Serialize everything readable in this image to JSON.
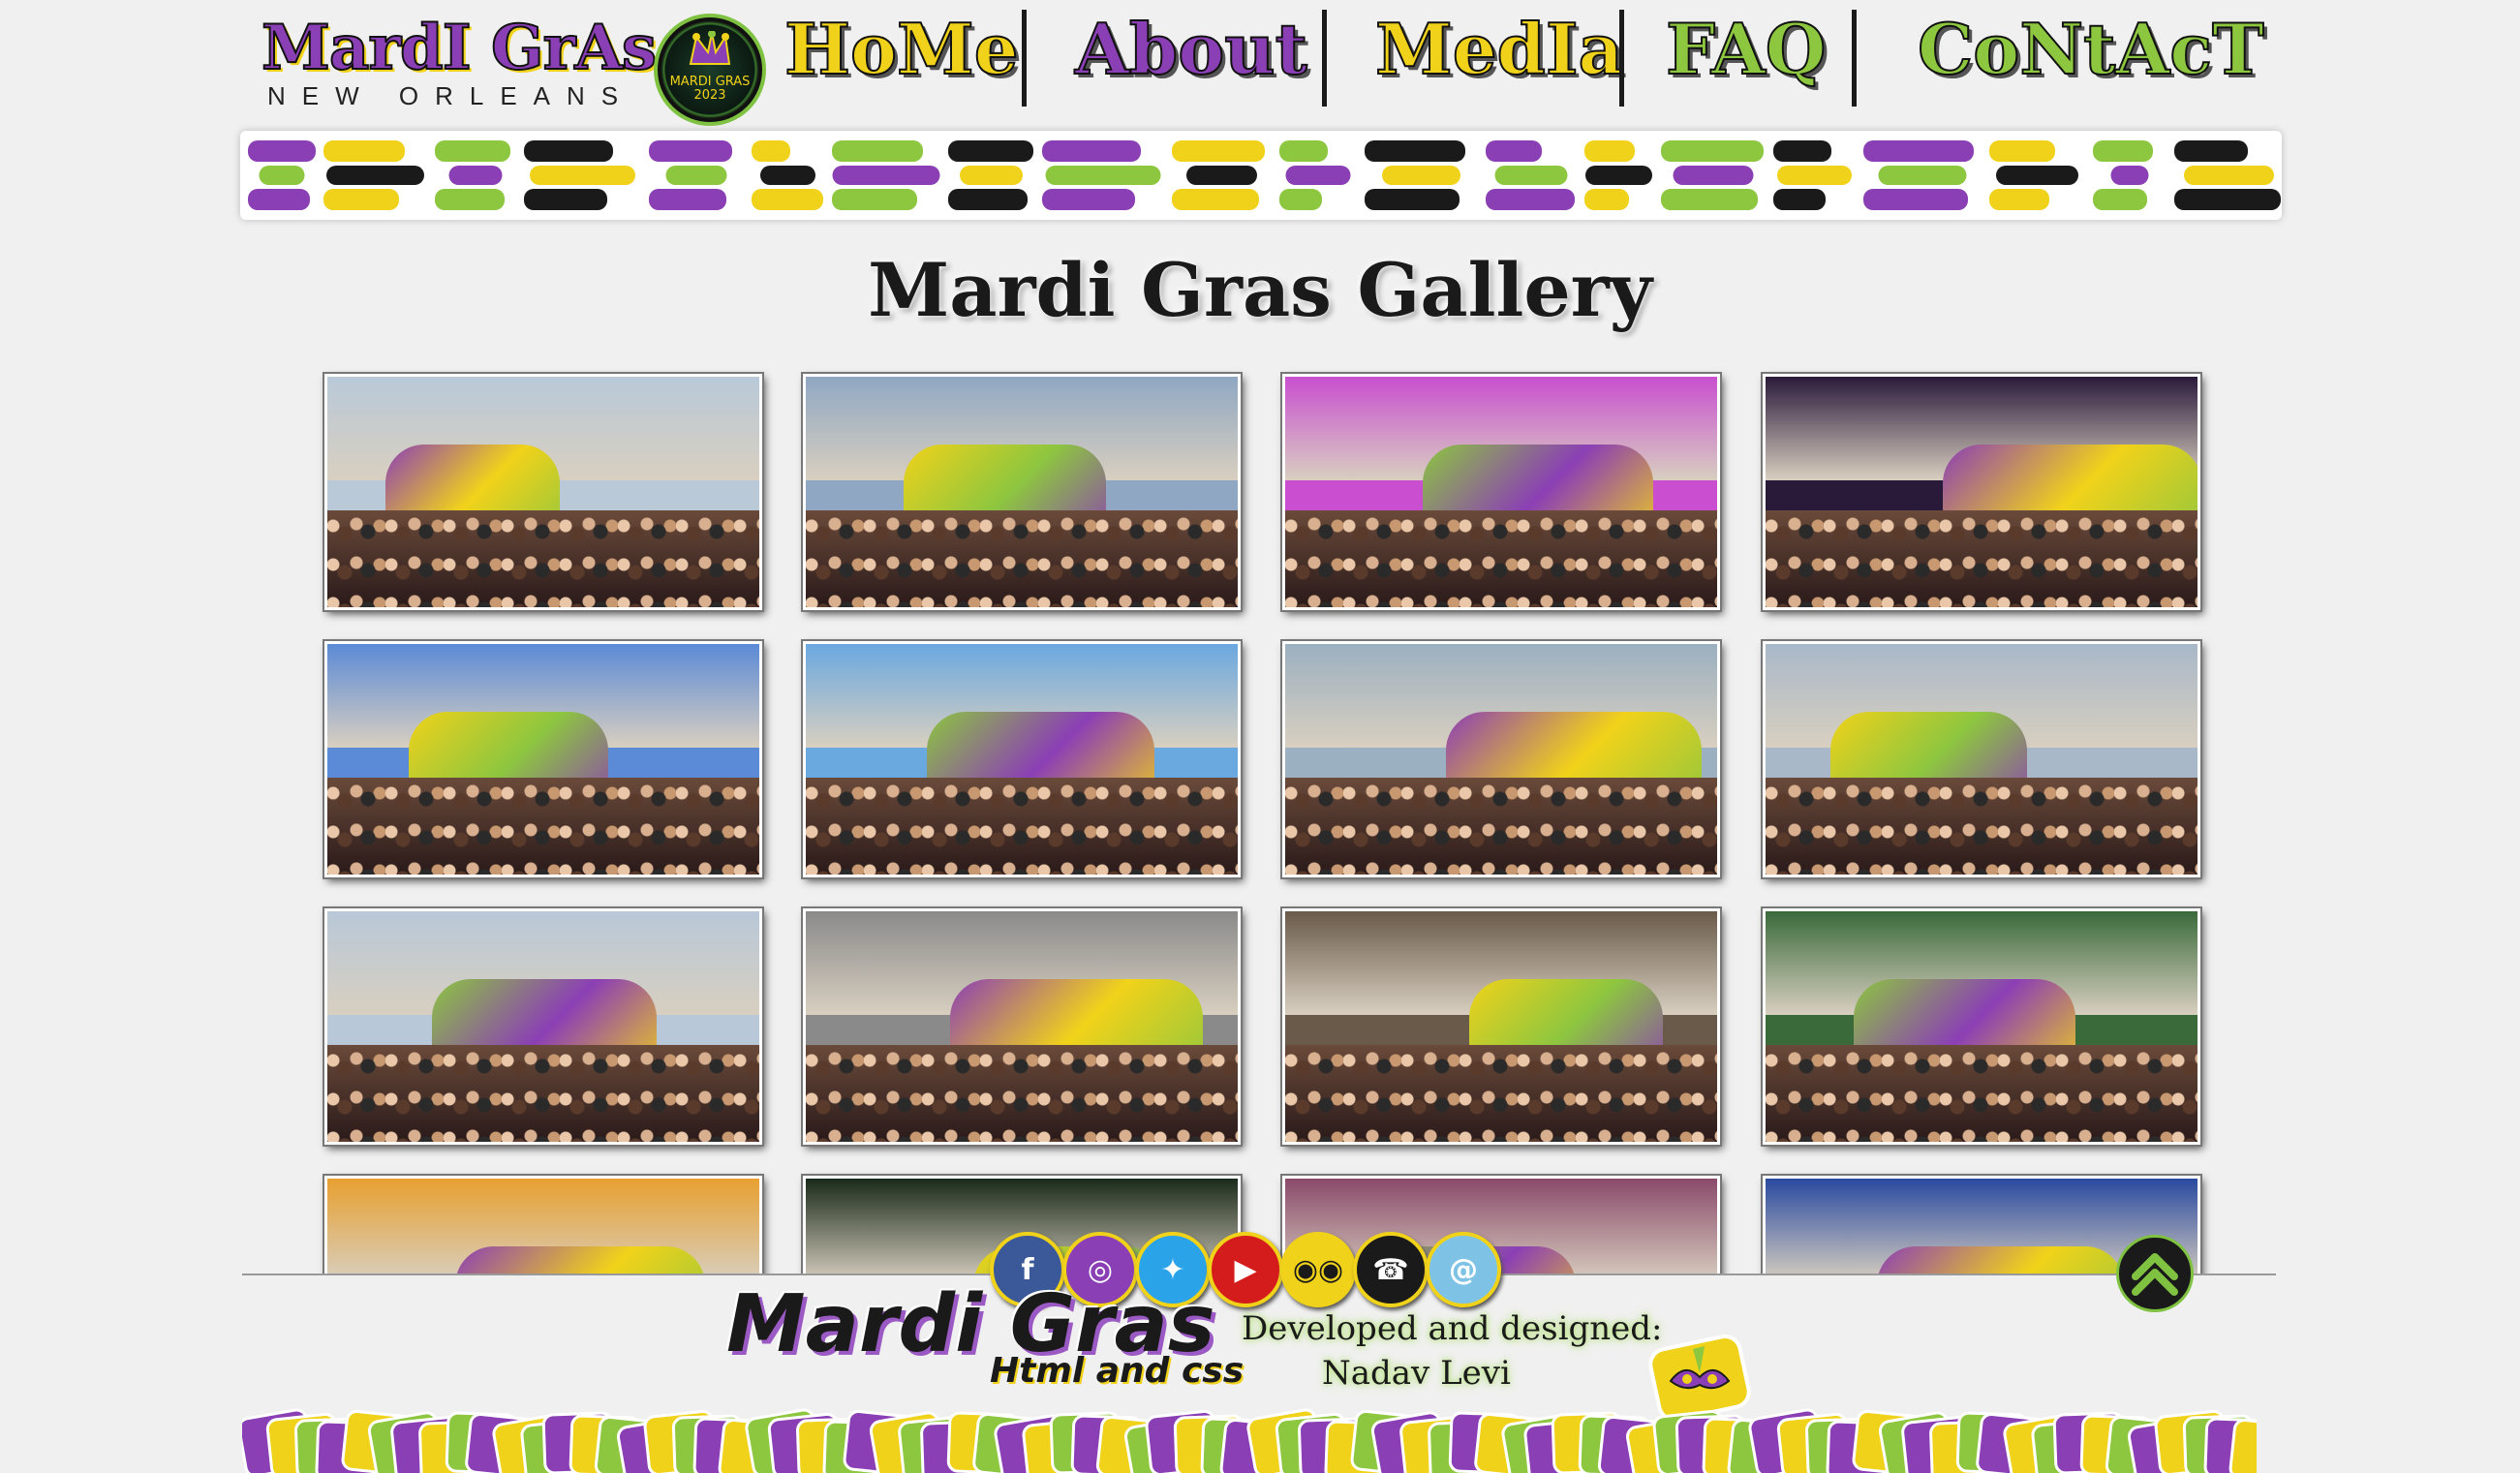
{
  "header": {
    "logo_title": "MardI GrAs",
    "logo_subtitle": "NEW ORLEANS",
    "badge_text_1": "MARDI GRAS",
    "badge_text_2": "2023",
    "nav": [
      {
        "label": "HoMe",
        "color": "#f1d21a"
      },
      {
        "label": "About",
        "color": "#8b3fb5"
      },
      {
        "label": "MedIa",
        "color": "#f1d21a"
      },
      {
        "label": "FAQ",
        "color": "#8dc63f"
      },
      {
        "label": "CoNtAcT",
        "color": "#8dc63f"
      }
    ]
  },
  "colors": {
    "purple": "#8b3fb5",
    "gold": "#f1d21a",
    "green": "#8dc63f",
    "black": "#1a1a1a"
  },
  "gallery": {
    "title": "Mardi Gras Gallery",
    "photos": [
      {
        "name": "photo-canal-street-parade"
      },
      {
        "name": "photo-crowd-float"
      },
      {
        "name": "photo-float-beads-catch"
      },
      {
        "name": "photo-night-float-confetti"
      },
      {
        "name": "photo-blue-cloud-float"
      },
      {
        "name": "photo-confetti-float"
      },
      {
        "name": "photo-jester-float"
      },
      {
        "name": "photo-french-quarter-balcony"
      },
      {
        "name": "photo-jester-head-float"
      },
      {
        "name": "photo-peacock-float"
      },
      {
        "name": "photo-costumed-revelers"
      },
      {
        "name": "photo-feathered-masks"
      },
      {
        "name": "photo-orange-smoke"
      },
      {
        "name": "photo-pink-feathers"
      },
      {
        "name": "photo-crowd-costumes"
      },
      {
        "name": "photo-white-feather-headdress"
      }
    ]
  },
  "social": [
    {
      "name": "facebook-icon",
      "glyph": "f",
      "color": "#3b5998"
    },
    {
      "name": "instagram-icon",
      "glyph": "◎",
      "color": "#8b3fb5"
    },
    {
      "name": "twitter-icon",
      "glyph": "✦",
      "color": "#2aa3e8"
    },
    {
      "name": "youtube-icon",
      "glyph": "▶",
      "color": "#d41c1c"
    },
    {
      "name": "tripadvisor-icon",
      "glyph": "◉◉",
      "color": "#f1d21a"
    },
    {
      "name": "phone-icon",
      "glyph": "☎",
      "color": "#1a1a1a"
    },
    {
      "name": "email-icon",
      "glyph": "@",
      "color": "#7ec3e6"
    }
  ],
  "footer": {
    "brand": "Mardi Gras",
    "sub": "Html and css",
    "credit_line1": "Developed and designed:",
    "credit_line2": "Nadav Levi"
  }
}
